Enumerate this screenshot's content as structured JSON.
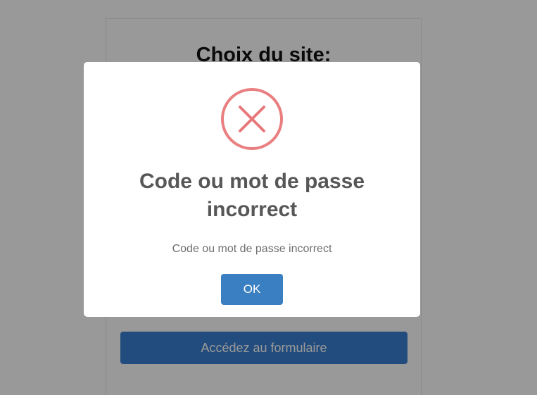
{
  "page": {
    "title": "Choix du site:",
    "submit_label": "Accédez au formulaire"
  },
  "modal": {
    "icon": "error-x-circle",
    "icon_color": "#e8787a",
    "title": "Code ou mot de passe incorrect",
    "message": "Code ou mot de passe incorrect",
    "ok_label": "OK",
    "ok_color": "#3a7fc1"
  },
  "colors": {
    "overlay": "rgba(0,0,0,0.4)",
    "primary_button": "#3a7fd0"
  }
}
